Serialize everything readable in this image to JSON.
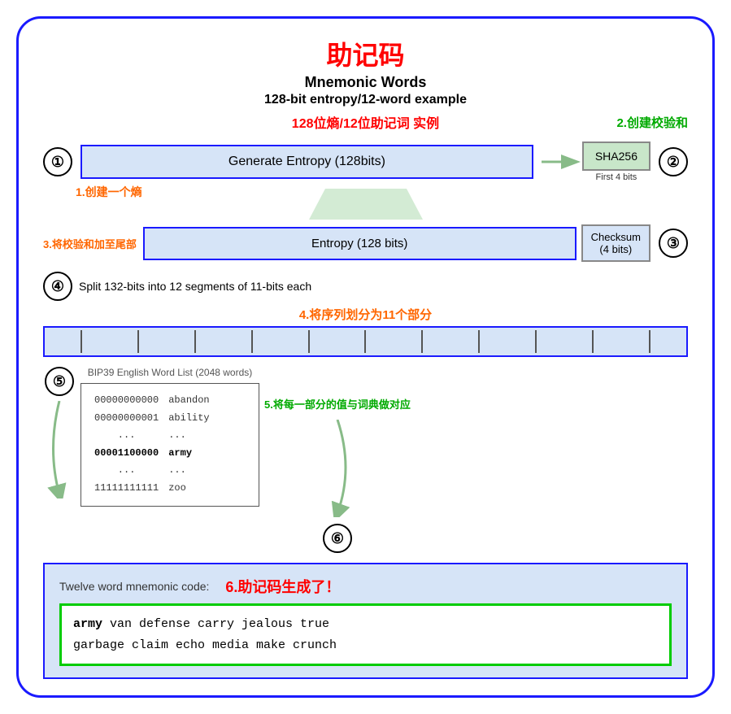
{
  "title": {
    "zh": "助记码",
    "en_line1": "Mnemonic Words",
    "en_line2": "128-bit entropy/12-word example",
    "zh_sub": "128位熵/12位助记词 实例"
  },
  "annotations": {
    "a2": "2.创建校验和",
    "a1": "1.创建一个熵",
    "a3": "3.将校验和加至尾部",
    "a4": "4.将序列划分为11个部分",
    "a5": "5.将每一部分的值与词典做对应",
    "a6": "6.助记码生成了！"
  },
  "step1": {
    "circle": "①",
    "box_text": "Generate Entropy (128bits)",
    "sha_label": "SHA256",
    "first4": "First 4 bits"
  },
  "step2_circle": "②",
  "step3": {
    "label": "3.将校验和加至尾部",
    "entropy_text": "Entropy (128 bits)",
    "checksum_line1": "Checksum",
    "checksum_line2": "(4 bits)",
    "circle": "③"
  },
  "step4": {
    "circle": "④",
    "text": "Split 132-bits into 12 segments of 11-bits each"
  },
  "step5": {
    "circle": "⑤",
    "wordlist_title": "BIP39 English Word List (2048 words)",
    "entries": [
      {
        "bin": "00000000000",
        "word": "abandon"
      },
      {
        "bin": "00000000001",
        "word": "ability"
      },
      {
        "bin": "...",
        "word": "..."
      },
      {
        "bin": "00001100000",
        "word": "army",
        "highlight": true
      },
      {
        "bin": "...",
        "word": "..."
      },
      {
        "bin": "11111111111",
        "word": "zoo"
      }
    ]
  },
  "step6": {
    "circle": "⑥",
    "label_en": "Twelve word mnemonic code:",
    "label_zh": "6.助记码生成了！",
    "mnemonic": "army van defense carry jealous true garbage claim echo media make crunch",
    "first_word": "army"
  }
}
